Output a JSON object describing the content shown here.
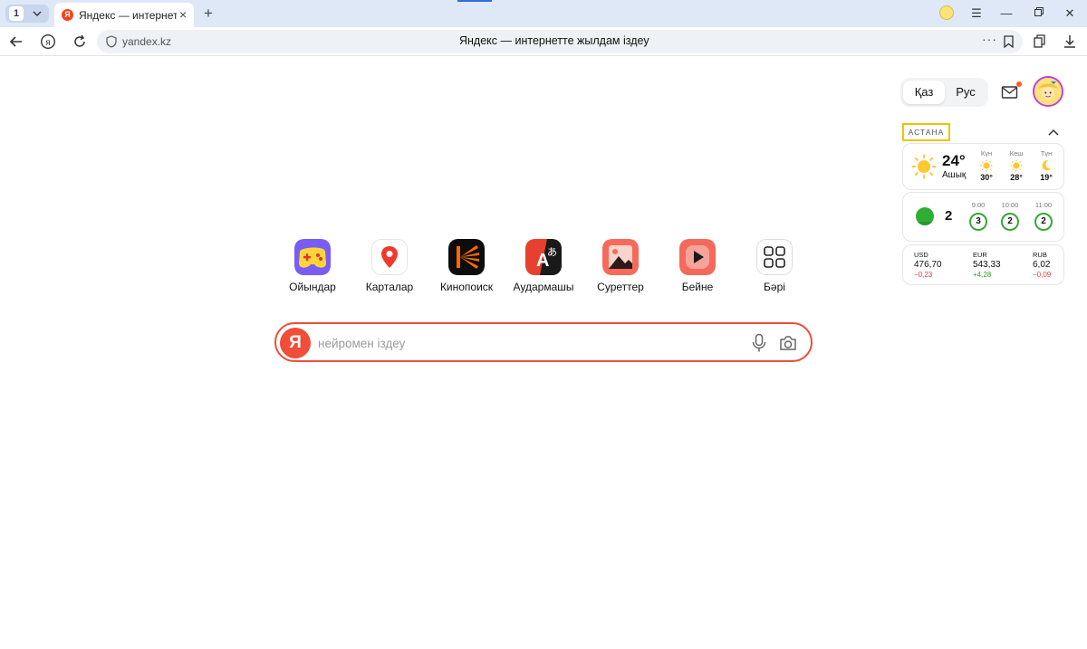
{
  "browser": {
    "tab_count": "1",
    "active_tab_title": "Яндекс — интернетте жылдам іздеу",
    "url": "yandex.kz",
    "page_title": "Яндекс — интернетте жылдам іздеу",
    "accent_color": "#2f6edb"
  },
  "header": {
    "languages": [
      {
        "label": "Қаз",
        "active": true
      },
      {
        "label": "Рус",
        "active": false
      }
    ],
    "mail_icon": "mail-icon",
    "notification_color": "#ff5a26"
  },
  "widgets": {
    "city": "АСТАНА",
    "weather": {
      "current_temp": "24°",
      "condition": "Ашық",
      "forecast": [
        {
          "label": "Күн",
          "icon": "sun-icon",
          "temp": "30°"
        },
        {
          "label": "Кеш",
          "icon": "sun-icon",
          "temp": "28°"
        },
        {
          "label": "Түн",
          "icon": "moon-icon",
          "temp": "19°"
        }
      ]
    },
    "traffic": {
      "level": "2",
      "forecast": [
        {
          "time": "9:00",
          "level": "3"
        },
        {
          "time": "10:00",
          "level": "2"
        },
        {
          "time": "11:00",
          "level": "2"
        }
      ]
    },
    "rates": [
      {
        "code": "USD",
        "value": "476,70",
        "change": "−0,23",
        "direction": "neg"
      },
      {
        "code": "EUR",
        "value": "543,33",
        "change": "+4,28",
        "direction": "pos"
      },
      {
        "code": "RUB",
        "value": "6,02",
        "change": "−0,09",
        "direction": "neg"
      }
    ]
  },
  "services": [
    {
      "label": "Ойындар",
      "icon": "games-icon"
    },
    {
      "label": "Карталар",
      "icon": "maps-icon"
    },
    {
      "label": "Кинопоиск",
      "icon": "kinopoisk-icon"
    },
    {
      "label": "Аудармашы",
      "icon": "translate-icon"
    },
    {
      "label": "Суреттер",
      "icon": "images-icon"
    },
    {
      "label": "Бейне",
      "icon": "video-icon"
    },
    {
      "label": "Бәрі",
      "icon": "all-services-icon"
    }
  ],
  "search": {
    "logo": "Я",
    "placeholder": "нейромен іздеу",
    "value": "",
    "border_color": "#ea4f3d"
  }
}
